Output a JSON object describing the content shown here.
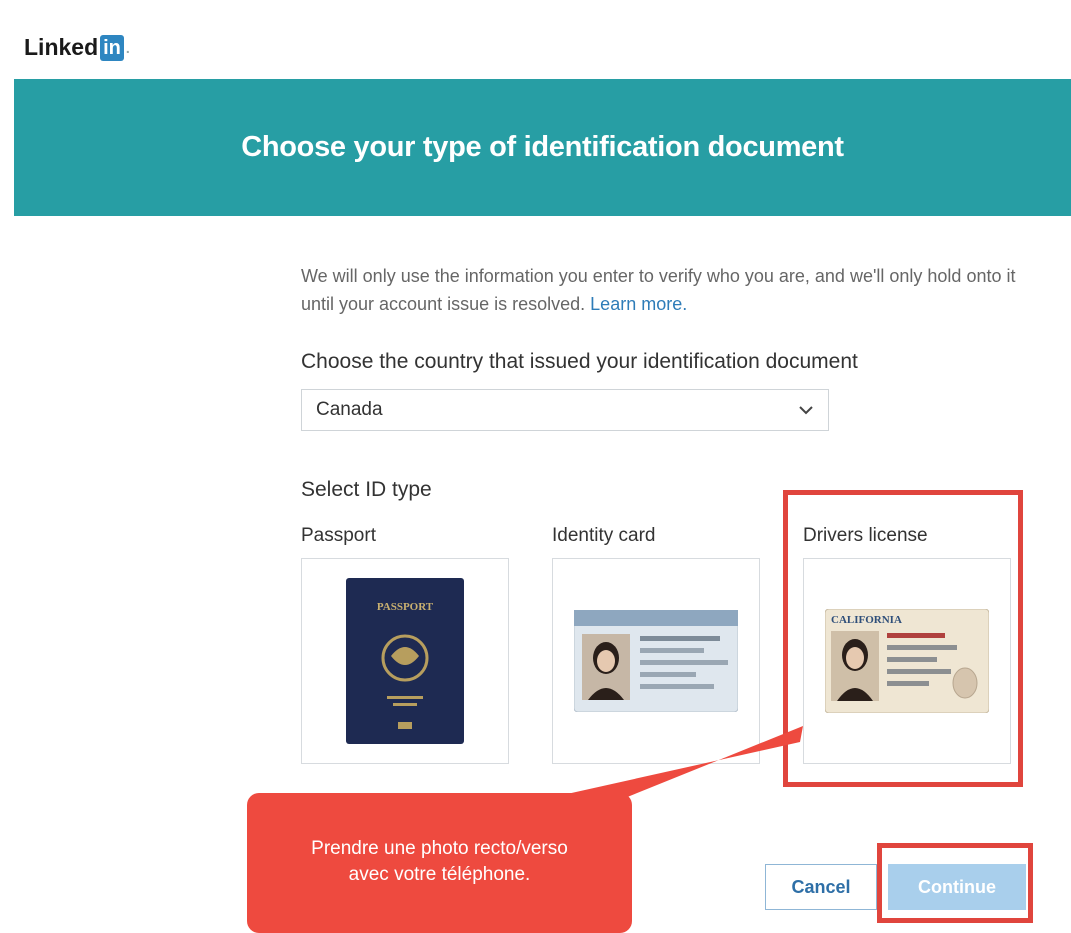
{
  "brand": {
    "name": "Linked",
    "mark": "in",
    "suffix": "."
  },
  "header": {
    "title": "Choose your type of identification document"
  },
  "intro": {
    "text": "We will only use the information you enter to verify who you are, and we'll only hold onto it until your account issue is resolved.",
    "link": "Learn more."
  },
  "country": {
    "label": "Choose the country that issued your identification document",
    "selected": "Canada"
  },
  "id_type": {
    "label": "Select ID type",
    "options": [
      {
        "label": "Passport",
        "image_text": "PASSPORT"
      },
      {
        "label": "Identity card"
      },
      {
        "label": "Drivers license",
        "image_text": "CALIFORNIA"
      }
    ]
  },
  "callout": {
    "line1": "Prendre une photo recto/verso",
    "line2": "avec votre téléphone."
  },
  "actions": {
    "cancel": "Cancel",
    "continue": "Continue"
  },
  "colors": {
    "banner": "#279ea4",
    "highlight": "#e0453d",
    "callout": "#ee4a3f",
    "link": "#2e7cb8",
    "continue_disabled": "#a9cfec"
  }
}
